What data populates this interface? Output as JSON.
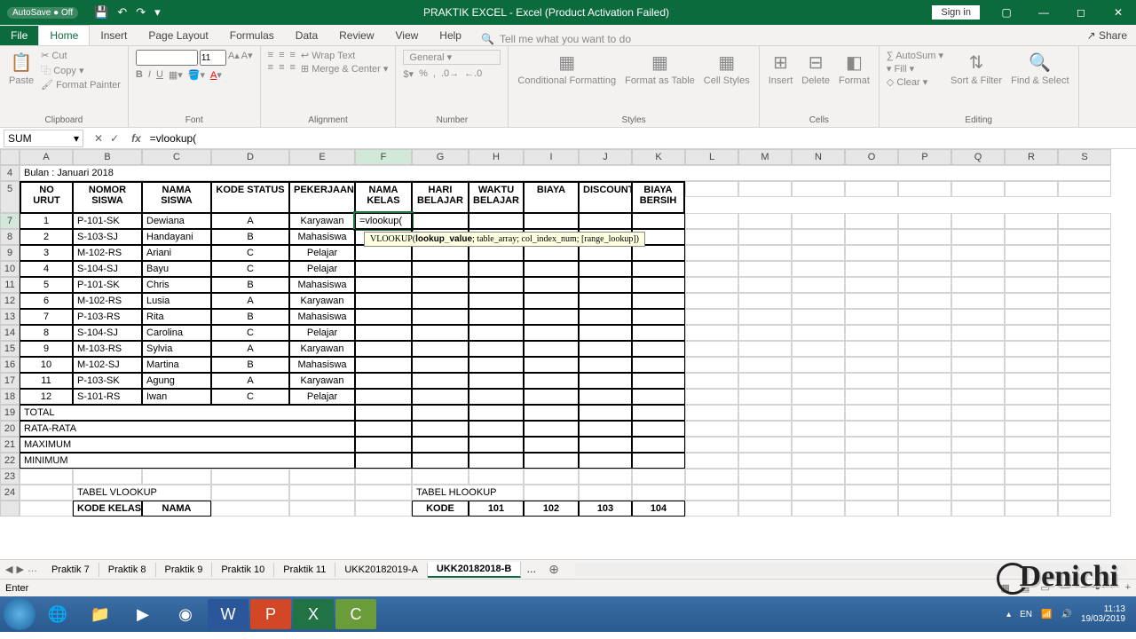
{
  "title": "PRAKTIK EXCEL  -  Excel (Product Activation Failed)",
  "autosave": "AutoSave ● Off",
  "signin": "Sign in",
  "tabs": [
    "File",
    "Home",
    "Insert",
    "Page Layout",
    "Formulas",
    "Data",
    "Review",
    "View",
    "Help"
  ],
  "tellme": "Tell me what you want to do",
  "share": "Share",
  "ribbon": {
    "clipboard": {
      "paste": "Paste",
      "cut": "Cut",
      "copy": "Copy",
      "fp": "Format Painter",
      "label": "Clipboard"
    },
    "font": {
      "name": "",
      "size": "11",
      "label": "Font"
    },
    "alignment": {
      "wrap": "Wrap Text",
      "merge": "Merge & Center",
      "label": "Alignment"
    },
    "number": {
      "general": "General",
      "label": "Number"
    },
    "styles": {
      "cf": "Conditional Formatting",
      "fat": "Format as Table",
      "cs": "Cell Styles",
      "label": "Styles"
    },
    "cells": {
      "ins": "Insert",
      "del": "Delete",
      "fmt": "Format",
      "label": "Cells"
    },
    "editing": {
      "sum": "AutoSum",
      "fill": "Fill",
      "clear": "Clear",
      "sort": "Sort & Filter",
      "find": "Find & Select",
      "label": "Editing"
    }
  },
  "namebox": "SUM",
  "formula": "=vlookup(",
  "tooltip": "VLOOKUP(lookup_value; table_array; col_index_num; [range_lookup])",
  "cols": [
    "A",
    "B",
    "C",
    "D",
    "E",
    "F",
    "G",
    "H",
    "I",
    "J",
    "K",
    "L",
    "M",
    "N",
    "O",
    "P",
    "Q",
    "R",
    "S"
  ],
  "row4": "Bulan : Januari 2018",
  "headers": [
    "NO URUT",
    "NOMOR SISWA",
    "NAMA SISWA",
    "KODE STATUS",
    "PEKERJAAN",
    "NAMA KELAS",
    "HARI BELAJAR",
    "WAKTU BELAJAR",
    "BIAYA",
    "DISCOUNT",
    "BIAYA BERSIH"
  ],
  "rows": [
    {
      "r": 7,
      "no": "1",
      "nomor": "P-101-SK",
      "nama": "Dewiana",
      "kode": "A",
      "pek": "Karyawan",
      "f": "=vlookup("
    },
    {
      "r": 8,
      "no": "2",
      "nomor": "S-103-SJ",
      "nama": "Handayani",
      "kode": "B",
      "pek": "Mahasiswa",
      "f": ""
    },
    {
      "r": 9,
      "no": "3",
      "nomor": "M-102-RS",
      "nama": "Ariani",
      "kode": "C",
      "pek": "Pelajar",
      "f": ""
    },
    {
      "r": 10,
      "no": "4",
      "nomor": "S-104-SJ",
      "nama": "Bayu",
      "kode": "C",
      "pek": "Pelajar",
      "f": ""
    },
    {
      "r": 11,
      "no": "5",
      "nomor": "P-101-SK",
      "nama": "Chris",
      "kode": "B",
      "pek": "Mahasiswa",
      "f": ""
    },
    {
      "r": 12,
      "no": "6",
      "nomor": "M-102-RS",
      "nama": "Lusia",
      "kode": "A",
      "pek": "Karyawan",
      "f": ""
    },
    {
      "r": 13,
      "no": "7",
      "nomor": "P-103-RS",
      "nama": "Rita",
      "kode": "B",
      "pek": "Mahasiswa",
      "f": ""
    },
    {
      "r": 14,
      "no": "8",
      "nomor": "S-104-SJ",
      "nama": "Carolina",
      "kode": "C",
      "pek": "Pelajar",
      "f": ""
    },
    {
      "r": 15,
      "no": "9",
      "nomor": "M-103-RS",
      "nama": "Sylvia",
      "kode": "A",
      "pek": "Karyawan",
      "f": ""
    },
    {
      "r": 16,
      "no": "10",
      "nomor": "M-102-SJ",
      "nama": "Martina",
      "kode": "B",
      "pek": "Mahasiswa",
      "f": ""
    },
    {
      "r": 17,
      "no": "11",
      "nomor": "P-103-SK",
      "nama": "Agung",
      "kode": "A",
      "pek": "Karyawan",
      "f": ""
    },
    {
      "r": 18,
      "no": "12",
      "nomor": "S-101-RS",
      "nama": "Iwan",
      "kode": "C",
      "pek": "Pelajar",
      "f": ""
    }
  ],
  "footer_rows": [
    {
      "r": 19,
      "a": "TOTAL"
    },
    {
      "r": 20,
      "a": "RATA-RATA"
    },
    {
      "r": 21,
      "a": "MAXIMUM"
    },
    {
      "r": 22,
      "a": "MINIMUM"
    }
  ],
  "tabel_vlookup": {
    "title": "TABEL VLOOKUP",
    "h1": "KODE KELAS",
    "h2": "NAMA"
  },
  "tabel_hlookup": {
    "title": "TABEL HLOOKUP",
    "h1": "KODE",
    "v1": "101",
    "v2": "102",
    "v3": "103",
    "v4": "104"
  },
  "sheets": [
    "Praktik 7",
    "Praktik 8",
    "Praktik 9",
    "Praktik 10",
    "Praktik 11",
    "UKK20182019-A",
    "UKK20182018-B"
  ],
  "status": "Enter",
  "tray": {
    "lang": "EN",
    "time": "11:13",
    "date": "19/03/2019"
  },
  "watermark": "Denichi"
}
